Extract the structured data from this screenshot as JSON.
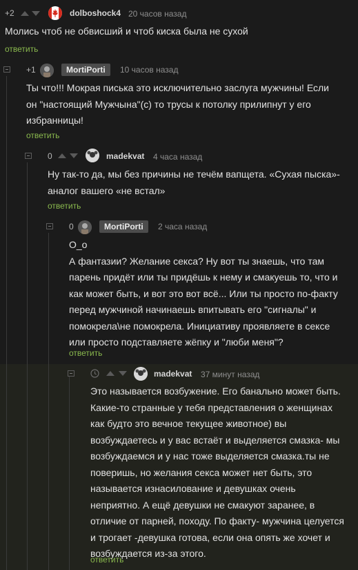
{
  "comments": [
    {
      "score": "+2",
      "author": "dolboshock4",
      "time": "20 часов назад",
      "text": [
        "Молись чтоб не обвисший и чтоб киска была не сухой"
      ],
      "reply": "ответить"
    },
    {
      "score": "+1",
      "author": "MortiPorti",
      "time": "10 часов назад",
      "text": [
        "Ты что!!! Мокрая писька это исключительно заслуга мужчины! Если",
        "он \"настоящий Мужчына\"(с) то трусы к потолку прилипнут у его",
        "избранницы!"
      ],
      "reply": "ответить"
    },
    {
      "score": "0",
      "author": "madekvat",
      "time": "4 часа назад",
      "text": [
        "Ну так-то да, мы без причины не течём вапщета. «Сухая пыска»-",
        "аналог вашего «не встал»"
      ],
      "reply": "ответить"
    },
    {
      "score": "0",
      "author": "MortiPorti",
      "time": "2 часа назад",
      "text": [
        "О_о",
        "А фантазии? Желание секса? Ну вот ты знаешь, что там",
        "парень придёт или ты придёшь к нему и смакуешь то, что и",
        "как может быть, и вот это вот всё... Или ты просто по-факту",
        "перед мужчиной начинаешь впитывать его \"сигналы\" и",
        "помокрела\\не помокрела. Инициативу проявляете в сексе",
        "или просто подставляете жёпку и \"люби меня\"?"
      ],
      "reply": "ответить"
    },
    {
      "score": "",
      "author": "madekvat",
      "time": "37 минут назад",
      "text": [
        "Это называется возбужение. Его банально может быть.",
        "Какие-то странные у тебя представления о женщинах",
        "как будто это вечное текущее животное) вы",
        "возбуждаетесь и у вас встаёт и выделяется смазка- мы",
        "возбуждаемся и у нас тоже выделяется смазка.ты не",
        "поверишь, но желания секса может нет быть, это",
        "называется изнасилование и девушках очень",
        "неприятно. А ещё девушки не смакуют заранее, в",
        "отличие от парней, походу. По факту- мужчина целуется",
        "и трогает -девушка готова, если она опять же хочет и",
        "возбуждается из-за этого."
      ],
      "reply": "ответить"
    }
  ],
  "icons": {
    "flag": "canada-flag-icon",
    "clock": "clock-icon",
    "collapse": "collapse-icon",
    "vote_up": "vote-up-icon",
    "vote_down": "vote-down-icon"
  },
  "colors": {
    "background": "#1b1b1b",
    "highlight_background": "#22231d",
    "reply_link": "#8ab94e",
    "name_tag_background": "#4c4c4c"
  }
}
